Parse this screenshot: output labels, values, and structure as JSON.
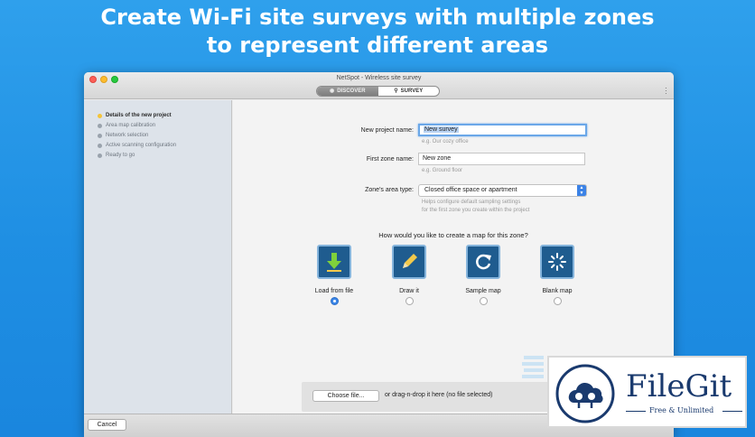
{
  "banner": {
    "line1": "Create Wi-Fi site surveys with multiple zones",
    "line2": "to represent different areas"
  },
  "window": {
    "title": "NetSpot - Wireless site survey",
    "modes": {
      "discover": "DISCOVER",
      "survey": "SURVEY",
      "active": "survey"
    }
  },
  "sidebar": {
    "steps": [
      {
        "label": "Details of the new project",
        "active": true
      },
      {
        "label": "Area map calibration",
        "active": false
      },
      {
        "label": "Network selection",
        "active": false
      },
      {
        "label": "Active scanning configuration",
        "active": false
      },
      {
        "label": "Ready to go",
        "active": false
      }
    ]
  },
  "form": {
    "project_name_label": "New project name:",
    "project_name_value": "New survey",
    "project_name_hint": "e.g. Our cozy office",
    "zone_name_label": "First zone name:",
    "zone_name_value": "New zone",
    "zone_name_hint": "e.g. Ground floor",
    "area_type_label": "Zone's area type:",
    "area_type_value": "Closed office space or apartment",
    "area_type_hint_1": "Helps configure default sampling settings",
    "area_type_hint_2": "for the first zone you create within the project"
  },
  "map_choice": {
    "question": "How would you like to create a map for this zone?",
    "options": [
      {
        "label": "Load from file",
        "icon": "download-arrow-icon",
        "selected": true
      },
      {
        "label": "Draw it",
        "icon": "pencil-icon",
        "selected": false
      },
      {
        "label": "Sample map",
        "icon": "refresh-icon",
        "selected": false
      },
      {
        "label": "Blank map",
        "icon": "spinner-icon",
        "selected": false
      }
    ]
  },
  "file": {
    "choose_label": "Choose file...",
    "drop_text": "or drag-n-drop it here (no file selected)"
  },
  "footer": {
    "cancel_label": "Cancel"
  },
  "watermark": {
    "name": "FileGit",
    "tagline": "Free & Unlimited"
  },
  "colors": {
    "background": "#1f8fe3",
    "accent": "#3a86e8",
    "icon_tile": "#1f5c8f",
    "active_step": "#f4c43a",
    "brand": "#1a3a6e"
  }
}
